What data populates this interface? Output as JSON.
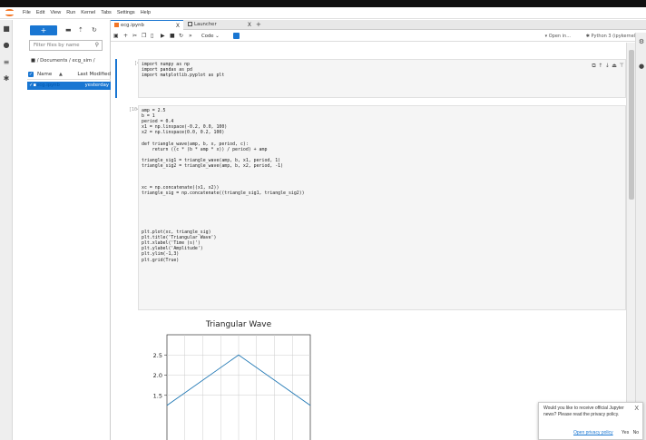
{
  "menubar": {
    "items": [
      "File",
      "Edit",
      "View",
      "Run",
      "Kernel",
      "Tabs",
      "Settings",
      "Help"
    ]
  },
  "browser": {
    "new_label": "+",
    "filter_placeholder": "Filter files by name",
    "breadcrumb": "/ Documents / ecg_sim /",
    "col_name": "Name",
    "col_modified": "Last Modified",
    "files": [
      {
        "name": "ecg.ipynb",
        "modified": "yesterday"
      }
    ]
  },
  "tabs": [
    {
      "label": "ecg.ipynb",
      "close": "X"
    },
    {
      "label": "Launcher",
      "close": "X"
    }
  ],
  "tab_add": "+",
  "toolbar": {
    "cell_type": "Code",
    "open_in": "Open in...",
    "kernel": "Python 3 (ipykernel)"
  },
  "cells": [
    {
      "prompt": "[4]:",
      "lines": [
        "import numpy as np",
        "import pandas as pd",
        "import matplotlib.pyplot as plt"
      ]
    },
    {
      "prompt": "[104]:",
      "lines": [
        "amp = 2.5",
        "b = 1",
        "period = 0.4",
        "x1 = np.linspace(-0.2, 0.0, 100)",
        "x2 = np.linspace(0.0, 0.2, 100)",
        "",
        "def triangle_wave(amp, b, x, period, c):",
        "    return ((c * (b * amp * x)) / period) + amp",
        "",
        "triangle_sig1 = triangle_wave(amp, b, x1, period, 1)",
        "triangle_sig2 = triangle_wave(amp, b, x2, period, -1)",
        "",
        "",
        "",
        "xc = np.concatenate((x1, x2))",
        "triangle_sig = np.concatenate((triangle_sig1, triangle_sig2))",
        "",
        "",
        "",
        "",
        "",
        "",
        "plt.plot(xc, triangle_sig)",
        "plt.title('Triangular Wave')",
        "plt.xlabel('Time (s)')",
        "plt.ylabel('Amplitude')",
        "plt.ylim(-1,3)",
        "plt.grid(True)",
        "",
        "",
        "",
        "",
        "",
        "",
        ""
      ]
    }
  ],
  "chart_data": {
    "type": "line",
    "title": "Triangular Wave",
    "x": [
      -0.2,
      0.0,
      0.2
    ],
    "y": [
      1.25,
      2.5,
      1.25
    ],
    "ylim": [
      -1,
      3
    ],
    "yticks": [
      "2.5",
      "2.0",
      "1.5"
    ],
    "grid": true,
    "color": "#1f77b4"
  },
  "toast": {
    "message": "Would you like to receive official Jupyter news? Please read the privacy policy.",
    "close": "X",
    "privacy_link": "Open privacy policy",
    "yes": "Yes",
    "no": "No"
  },
  "colors": {
    "accent": "#1976d2",
    "logo": "#f37626"
  }
}
